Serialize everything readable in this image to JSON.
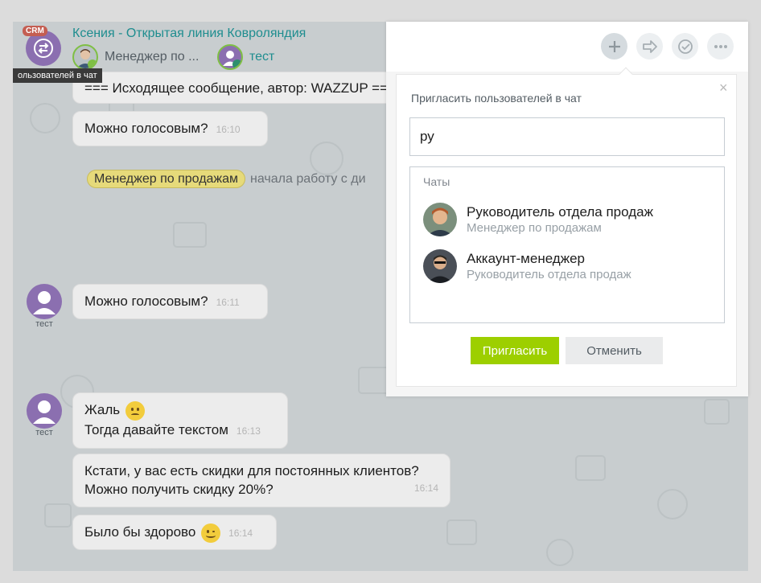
{
  "header": {
    "crm_badge": "CRM",
    "title": "Ксения - Открытая линия Ковроляндия",
    "participants": [
      {
        "label": "Менеджер по ..."
      },
      {
        "label": "тест"
      }
    ],
    "tooltip": "ользователей в чат"
  },
  "messages": {
    "outgoing_header": "=== Исходящее сообщение, автор: WAZZUP ===",
    "m1": {
      "text": "Можно голосовым?",
      "time": "16:10"
    },
    "system": {
      "tag": "Менеджер по продажам",
      "text": "начала работу с ди"
    },
    "m2": {
      "author": "тест",
      "text": "Можно голосовым?",
      "time": "16:11"
    },
    "m3": {
      "author": "тест",
      "line1": "Жаль",
      "line2": "Тогда давайте текстом",
      "time": "16:13"
    },
    "m4": {
      "line1": "Кстати, у вас есть скидки для постоянных клиентов?",
      "line2": "Можно получить скидку 20%?",
      "time": "16:14"
    },
    "m5": {
      "text": "Было бы здорово",
      "time": "16:14"
    }
  },
  "toolbar": {
    "icons": [
      "plus-icon",
      "forward-icon",
      "check-circle-icon",
      "more-icon"
    ]
  },
  "invite_panel": {
    "title": "Пригласить пользователей в чат",
    "search_value": "ру",
    "results_heading": "Чаты",
    "results": [
      {
        "name": "Руководитель отдела продаж",
        "subtitle": "Менеджер по продажам"
      },
      {
        "name": "Аккаунт-менеджер",
        "subtitle": "Руководитель отдела продаж"
      }
    ],
    "invite_label": "Пригласить",
    "cancel_label": "Отменить",
    "close_glyph": "×"
  },
  "colors": {
    "accent_green": "#9dcf00",
    "title_teal": "#1e8d8f",
    "avatar_purple": "#8b6fb0"
  }
}
